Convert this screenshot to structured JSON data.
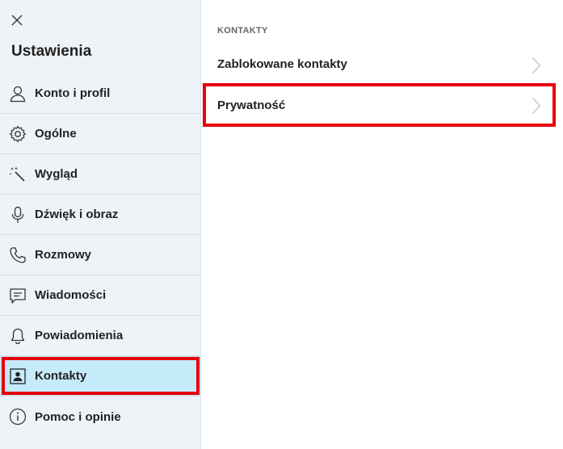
{
  "sidebar": {
    "title": "Ustawienia",
    "close_icon": "close-icon",
    "items": [
      {
        "label": "Konto i profil",
        "icon": "person-icon"
      },
      {
        "label": "Ogólne",
        "icon": "gear-icon"
      },
      {
        "label": "Wygląd",
        "icon": "magic-wand-icon"
      },
      {
        "label": "Dźwięk i obraz",
        "icon": "microphone-icon"
      },
      {
        "label": "Rozmowy",
        "icon": "phone-icon"
      },
      {
        "label": "Wiadomości",
        "icon": "message-icon"
      },
      {
        "label": "Powiadomienia",
        "icon": "bell-icon"
      },
      {
        "label": "Kontakty",
        "icon": "contacts-icon",
        "active": true
      },
      {
        "label": "Pomoc i opinie",
        "icon": "info-icon"
      }
    ]
  },
  "main": {
    "section_heading": "KONTAKTY",
    "rows": [
      {
        "label": "Zablokowane kontakty",
        "icon": "chevron-right-icon"
      },
      {
        "label": "Prywatność",
        "icon": "chevron-right-icon",
        "highlighted": true
      }
    ]
  },
  "colors": {
    "sidebar_bg": "#eef3f8",
    "active_bg": "#c5eafa",
    "highlight_border": "#e8000c"
  }
}
